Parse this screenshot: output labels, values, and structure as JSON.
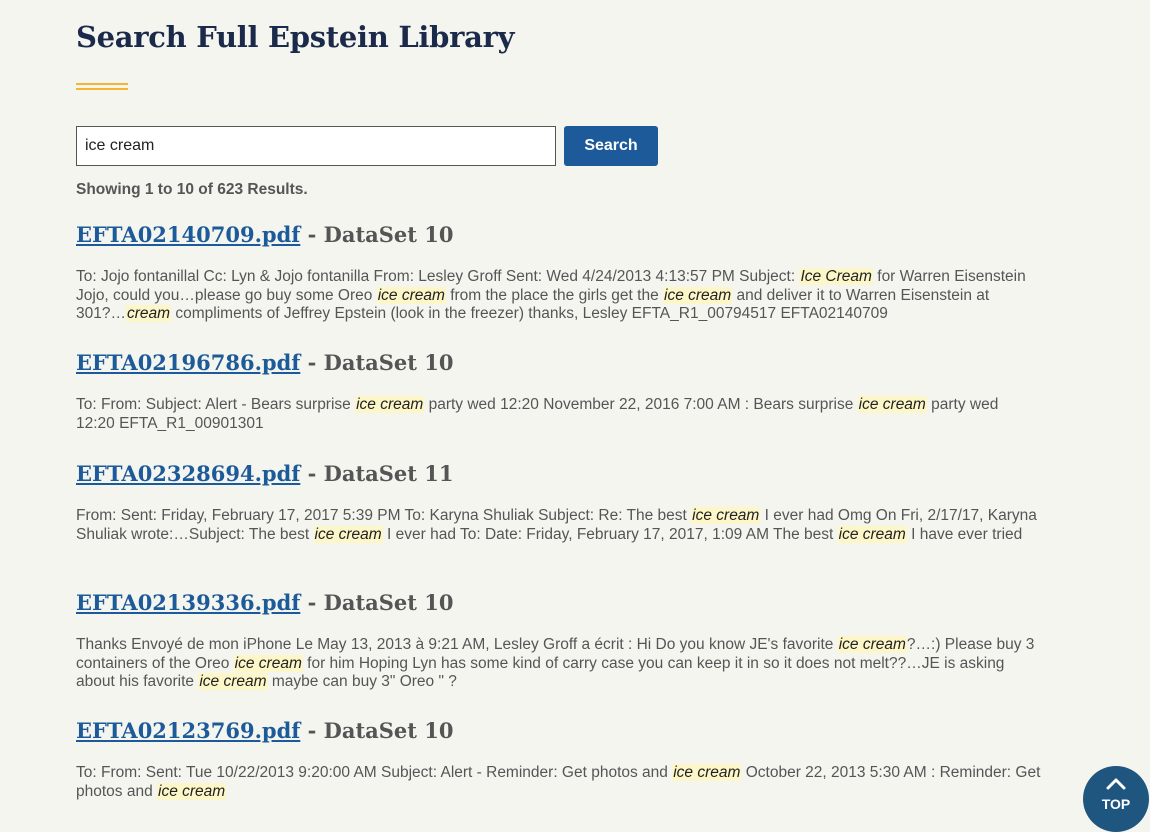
{
  "page": {
    "title": "Search Full Epstein Library"
  },
  "search": {
    "value": "ice cream",
    "button_label": "Search"
  },
  "results_count": "Showing 1 to 10 of 623 Results.",
  "results": [
    {
      "file": "EFTA02140709.pdf",
      "sep": " - ",
      "dataset": "DataSet 10",
      "snippet": [
        {
          "t": "To: Jojo fontanillal Cc: Lyn & Jojo fontanilla From: Lesley Groff Sent: Wed 4/24/2013 4:13:57 PM Subject: "
        },
        {
          "t": "Ice Cream",
          "hl": true
        },
        {
          "t": " for Warren Eisenstein Jojo, could you…please go buy some Oreo "
        },
        {
          "t": "ice cream",
          "hl": true
        },
        {
          "t": " from the place the girls get the "
        },
        {
          "t": "ice cream",
          "hl": true
        },
        {
          "t": " and deliver it to Warren Eisenstein at 301?…"
        },
        {
          "t": "cream",
          "hl": true
        },
        {
          "t": " compliments of Jeffrey Epstein (look in the freezer) thanks, Lesley EFTA_R1_00794517 EFTA02140709"
        }
      ]
    },
    {
      "file": "EFTA02196786.pdf",
      "sep": " - ",
      "dataset": "DataSet 10",
      "snippet": [
        {
          "t": "To: From: Subject: Alert - Bears surprise "
        },
        {
          "t": "ice cream",
          "hl": true
        },
        {
          "t": " party wed 12:20 November 22, 2016 7:00 AM : Bears surprise "
        },
        {
          "t": "ice cream",
          "hl": true
        },
        {
          "t": " party wed 12:20 EFTA_R1_00901301"
        }
      ]
    },
    {
      "file": "EFTA02328694.pdf",
      "sep": " - ",
      "dataset": "DataSet 11",
      "snippet": [
        {
          "t": "From: Sent: Friday, February 17, 2017 5:39 PM To: Karyna Shuliak Subject: Re: The best "
        },
        {
          "t": "ice cream",
          "hl": true
        },
        {
          "t": " I ever had Omg On Fri, 2/17/17, Karyna Shuliak wrote:…Subject: The best "
        },
        {
          "t": "ice cream",
          "hl": true
        },
        {
          "t": " I ever had To: Date: Friday, February 17, 2017, 1:09 AM The best "
        },
        {
          "t": "ice cream",
          "hl": true
        },
        {
          "t": " I have ever tried"
        }
      ]
    },
    {
      "file": "EFTA02139336.pdf",
      "sep": " - ",
      "dataset": "DataSet 10",
      "snippet": [
        {
          "t": "Thanks Envoyé de mon iPhone Le May 13, 2013 à 9:21 AM, Lesley Groff a écrit : Hi Do you know JE's favorite "
        },
        {
          "t": "ice cream",
          "hl": true
        },
        {
          "t": "?…:) Please buy 3 containers of the Oreo "
        },
        {
          "t": "ice cream",
          "hl": true
        },
        {
          "t": " for him Hoping Lyn has some kind of carry case you can keep it in so it does not melt??…JE is asking about his favorite "
        },
        {
          "t": "ice cream",
          "hl": true
        },
        {
          "t": " maybe can buy 3\" Oreo \" ?"
        }
      ]
    },
    {
      "file": "EFTA02123769.pdf",
      "sep": " - ",
      "dataset": "DataSet 10",
      "snippet": [
        {
          "t": "To: From: Sent: Tue 10/22/2013 9:20:00 AM Subject: Alert - Reminder: Get photos and "
        },
        {
          "t": "ice cream",
          "hl": true
        },
        {
          "t": " October 22, 2013 5:30 AM : Reminder: Get photos and "
        },
        {
          "t": "ice cream",
          "hl": true
        }
      ]
    }
  ],
  "top_button": {
    "label": "TOP",
    "icon": "chevron-up-icon"
  },
  "colors": {
    "accent": "#f2b632",
    "link": "#1d5a99",
    "button": "#1d5a99",
    "highlight": "#fdf6c8",
    "top_button": "#1f5680"
  }
}
